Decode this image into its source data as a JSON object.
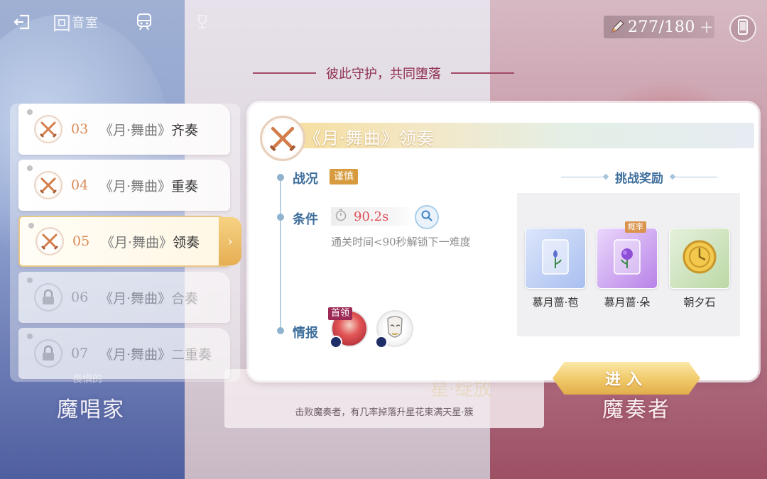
{
  "top_bar": {
    "title_main": "回",
    "title_small": "音室",
    "stamina": "277/180",
    "stamina_plus": "+"
  },
  "subtitle": "彼此守护，共同堕落",
  "background": {
    "left_label": "魔唱家",
    "left_sub": "畏惧的",
    "right_label": "魔奏者",
    "card_text": "击败魔奏者，有几率掉落升星花束满天星·簇",
    "deco_text": "星·绽放"
  },
  "levels": [
    {
      "num": "03",
      "prefix": "《月·舞曲》",
      "suffix": "齐奏",
      "state": "normal"
    },
    {
      "num": "04",
      "prefix": "《月·舞曲》",
      "suffix": "重奏",
      "state": "normal"
    },
    {
      "num": "05",
      "prefix": "《月·舞曲》",
      "suffix": "领奏",
      "state": "selected"
    },
    {
      "num": "06",
      "prefix": "《月·舞曲》",
      "suffix": "合奏",
      "state": "locked"
    },
    {
      "num": "07",
      "prefix": "《月·舞曲》",
      "suffix": "二重奏",
      "state": "locked"
    }
  ],
  "selected_arrow": "›",
  "detail": {
    "title": "《月·舞曲》领奏",
    "status_label": "战况",
    "status_tag": "谨慎",
    "condition_label": "条件",
    "condition_value": "90.2s",
    "condition_note": "通关时间<90秒解锁下一难度",
    "intel_label": "情报",
    "boss_tag": "首领",
    "reward_title": "挑战奖励",
    "probability_tag": "概率",
    "rewards": [
      {
        "name": "慕月蔷·苞",
        "color": "blue"
      },
      {
        "name": "慕月蔷·朵",
        "color": "purple"
      },
      {
        "name": "朝夕石",
        "color": "green"
      }
    ]
  },
  "enter_button": "进入",
  "colors": {
    "accent_gold": "#e6ae53",
    "label_blue": "#3f6f9c",
    "level_number": "#d98a54",
    "condition_red": "#e0505a",
    "subtitle_red": "#8e2e4e"
  }
}
